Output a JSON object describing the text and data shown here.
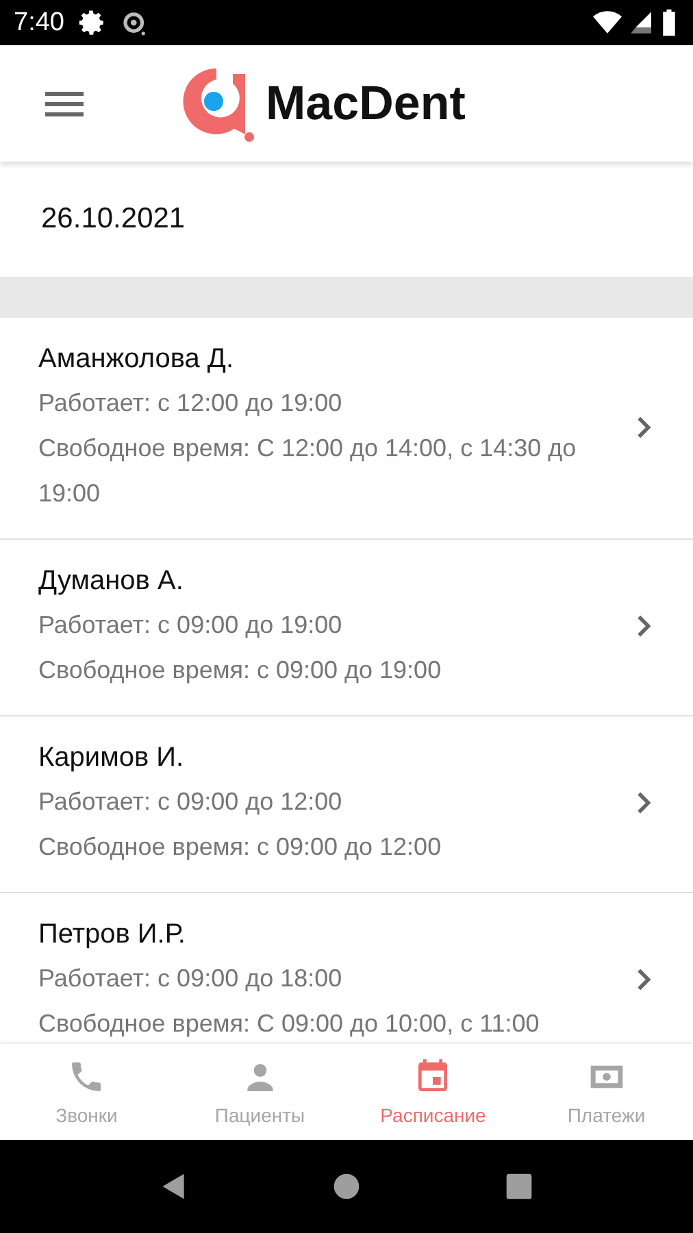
{
  "status_bar": {
    "time": "7:40"
  },
  "app_bar": {
    "title": "MacDent"
  },
  "date": "26.10.2021",
  "doctors": [
    {
      "name": "Аманжолова Д.",
      "working": "Работает: с 12:00 до 19:00",
      "free": "Свободное время: С 12:00 до 14:00, с 14:30 до 19:00"
    },
    {
      "name": "Думанов А.",
      "working": "Работает: с 09:00 до 19:00",
      "free": "Свободное время: с 09:00 до 19:00"
    },
    {
      "name": "Каримов И.",
      "working": "Работает: с 09:00 до 12:00",
      "free": "Свободное время: с 09:00 до 12:00"
    },
    {
      "name": "Петров И.Р.",
      "working": "Работает: с 09:00 до 18:00",
      "free": "Свободное время: С 09:00 до 10:00, с 11:00"
    }
  ],
  "bottom_nav": [
    {
      "kind": "phone",
      "label": "Звонки",
      "selected": false
    },
    {
      "kind": "person",
      "label": "Пациенты",
      "selected": false
    },
    {
      "kind": "calendar",
      "label": "Расписание",
      "selected": true
    },
    {
      "kind": "money",
      "label": "Платежи",
      "selected": false
    }
  ]
}
